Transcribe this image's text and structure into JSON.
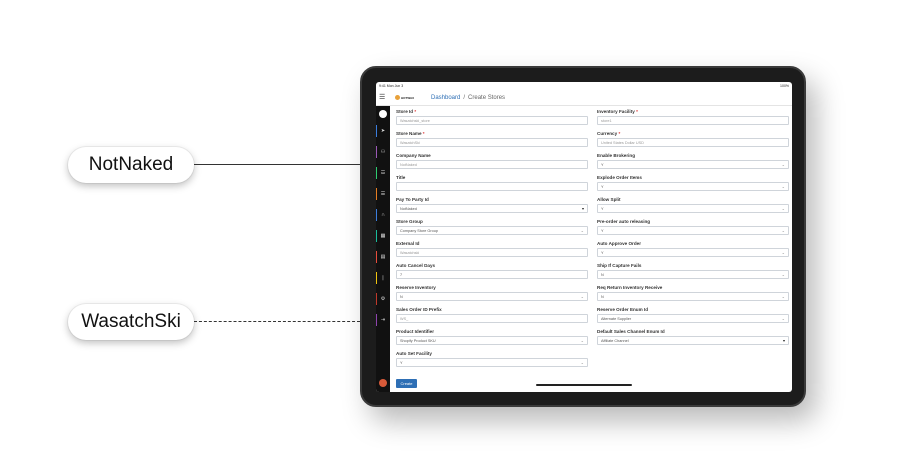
{
  "callouts": {
    "top": "NotNaked",
    "bottom": "WasatchSki"
  },
  "status": {
    "time": "9:41",
    "date": "Mon Jun 3",
    "battery": "100%"
  },
  "header": {
    "logo_text": "HOTWAX",
    "crumb_home": "Dashboard",
    "crumb_sep": "/",
    "crumb_current": "Create Stores"
  },
  "sidebar_icons": [
    "home-icon",
    "send-icon",
    "users-icon",
    "sitemap-icon",
    "list-icon",
    "magnet-icon",
    "grid-icon",
    "clipboard-icon",
    "pin-icon",
    "gear-icon",
    "login-icon"
  ],
  "accent": "#2e6fb5",
  "form": {
    "left": [
      {
        "label": "Store Id",
        "required": true,
        "value": "Wasatchski_store",
        "placeholder": true,
        "kind": "text"
      },
      {
        "label": "Store Name",
        "required": true,
        "value": "WasatchSki",
        "placeholder": true,
        "kind": "text"
      },
      {
        "label": "Company Name",
        "required": false,
        "value": "NotNaked",
        "placeholder": true,
        "kind": "text"
      },
      {
        "label": "Title",
        "required": false,
        "value": "",
        "placeholder": false,
        "kind": "text"
      },
      {
        "label": "Pay To Party Id",
        "required": false,
        "value": "NotNaked",
        "placeholder": false,
        "kind": "select-dark"
      },
      {
        "label": "Store Group",
        "required": false,
        "value": "Company Store Group",
        "placeholder": false,
        "kind": "select"
      },
      {
        "label": "External Id",
        "required": false,
        "value": "Wasatchski",
        "placeholder": true,
        "kind": "text"
      },
      {
        "label": "Auto Cancel Days",
        "required": false,
        "value": "7",
        "placeholder": false,
        "kind": "text"
      },
      {
        "label": "Reserve Inventory",
        "required": false,
        "value": "N",
        "placeholder": false,
        "kind": "select"
      },
      {
        "label": "Sales Order ID Prefix",
        "required": false,
        "value": "WS_",
        "placeholder": true,
        "kind": "text"
      },
      {
        "label": "Product Identifier",
        "required": false,
        "value": "Shopify Product SKU",
        "placeholder": false,
        "kind": "select"
      },
      {
        "label": "Auto Set Facility",
        "required": false,
        "value": "Y",
        "placeholder": false,
        "kind": "select"
      }
    ],
    "right": [
      {
        "label": "Inventory Facility",
        "required": true,
        "value": "store1",
        "placeholder": true,
        "kind": "text"
      },
      {
        "label": "Currency",
        "required": true,
        "value": "United States Dollar USD",
        "placeholder": true,
        "kind": "text"
      },
      {
        "label": "Enable Brokering",
        "required": false,
        "value": "Y",
        "placeholder": false,
        "kind": "select"
      },
      {
        "label": "Explode Order Items",
        "required": false,
        "value": "Y",
        "placeholder": false,
        "kind": "select"
      },
      {
        "label": "Allow Split",
        "required": false,
        "value": "Y",
        "placeholder": false,
        "kind": "select"
      },
      {
        "label": "Pre-order auto releasing",
        "required": false,
        "value": "Y",
        "placeholder": false,
        "kind": "select"
      },
      {
        "label": "Auto Approve Order",
        "required": false,
        "value": "Y",
        "placeholder": false,
        "kind": "select"
      },
      {
        "label": "Ship If Capture Fails",
        "required": false,
        "value": "N",
        "placeholder": false,
        "kind": "select"
      },
      {
        "label": "Req Return Inventory Receive",
        "required": false,
        "value": "N",
        "placeholder": false,
        "kind": "select"
      },
      {
        "label": "Reserve Order Enum Id",
        "required": false,
        "value": "Alternate Supplier",
        "placeholder": false,
        "kind": "select"
      },
      {
        "label": "Default Sales Channel Enum Id",
        "required": false,
        "value": "Affiliate Channel",
        "placeholder": false,
        "kind": "select-dark"
      }
    ],
    "submit": "Create"
  }
}
